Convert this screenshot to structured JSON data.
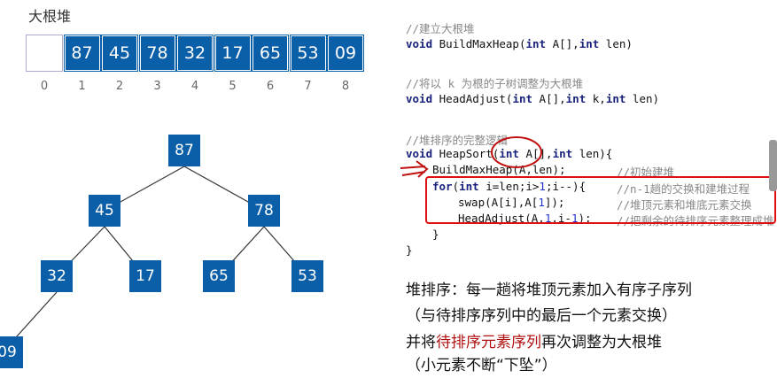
{
  "heap_title": "大根堆",
  "array": [
    "",
    "87",
    "45",
    "78",
    "32",
    "17",
    "65",
    "53",
    "09"
  ],
  "indices": [
    "0",
    "1",
    "2",
    "3",
    "4",
    "5",
    "6",
    "7",
    "8"
  ],
  "tree": {
    "n1": "87",
    "n2": "45",
    "n3": "78",
    "n4": "32",
    "n5": "17",
    "n6": "65",
    "n7": "53",
    "n8": "09"
  },
  "code": {
    "c1": "//建立大根堆",
    "l1": "BuildMaxHeap(",
    "c2": "//将以 k 为根的子树调整为大根堆",
    "l2": "HeadAdjust(",
    "c3": "//堆排序的完整逻辑",
    "l3": "HeapSort(",
    "l4": "BuildMaxHeap(A,len);",
    "c4": "//初始建堆",
    "c5": "//n-1趟的交换和建堆过程",
    "l6": "swap(A[i],A[",
    "c6": "//堆顶元素和堆底元素交换",
    "l7": "HeadAdjust(A,",
    "c7": "//把剩余的待排序元素整理成堆"
  },
  "notes": {
    "p1": "堆排序：每一趟将堆顶元素加入有序子序列",
    "p2": "（与待排序序列中的最后一个元素交换）",
    "p3a": "并将",
    "p3b": "待排序元素序列",
    "p3c": "再次调整为大根堆",
    "p4": "（小元素不断“下坠”）"
  },
  "colors": {
    "node": "#0b5ea8",
    "annotation": "#d01010"
  }
}
